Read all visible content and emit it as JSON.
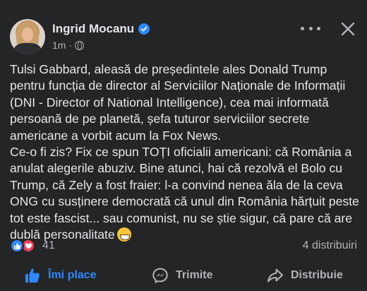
{
  "post": {
    "author": "Ingrid Mocanu",
    "time": "1m",
    "separator": "·",
    "text": "Tulsi Gabbard, aleasă de președintele ales Donald Trump pentru funcția de director al Serviciilor Naționale de Informații (DNI - Director of National Intelligence), cea mai informată persoană de pe planetă, șefa tuturor serviciilor secrete americane a vorbit acum la Fox News.\nCe-o fi zis? Fix ce spun TOȚI oficialii americani: că România a anulat alegerile abuziv. Bine atunci, hai că rezolvă el Bolo cu Trump, că Zely a fost fraier: l-a convind nenea ăla de la ceva ONG cu susținere democrată că unul din România hărțuit peste tot este fascist... sau comunist, nu se știe sigur, că pare că are dublă personalitate",
    "emoji": "grinning-face-emoji"
  },
  "stats": {
    "reaction_count": "41",
    "shares": "4 distribuiri"
  },
  "actions": {
    "like": "Îmi place",
    "send": "Trimite",
    "share": "Distribuie"
  },
  "colors": {
    "background": "#242526",
    "text": "#e4e6eb",
    "secondary": "#b0b3b8",
    "accent": "#2d88ff",
    "love": "#f33e58"
  },
  "icons": {
    "verified": "verified-badge-icon",
    "privacy": "globe-icon",
    "more": "more-options-icon",
    "close": "close-icon",
    "like": "thumbs-up-icon",
    "send": "messenger-icon",
    "share": "share-arrow-icon"
  }
}
